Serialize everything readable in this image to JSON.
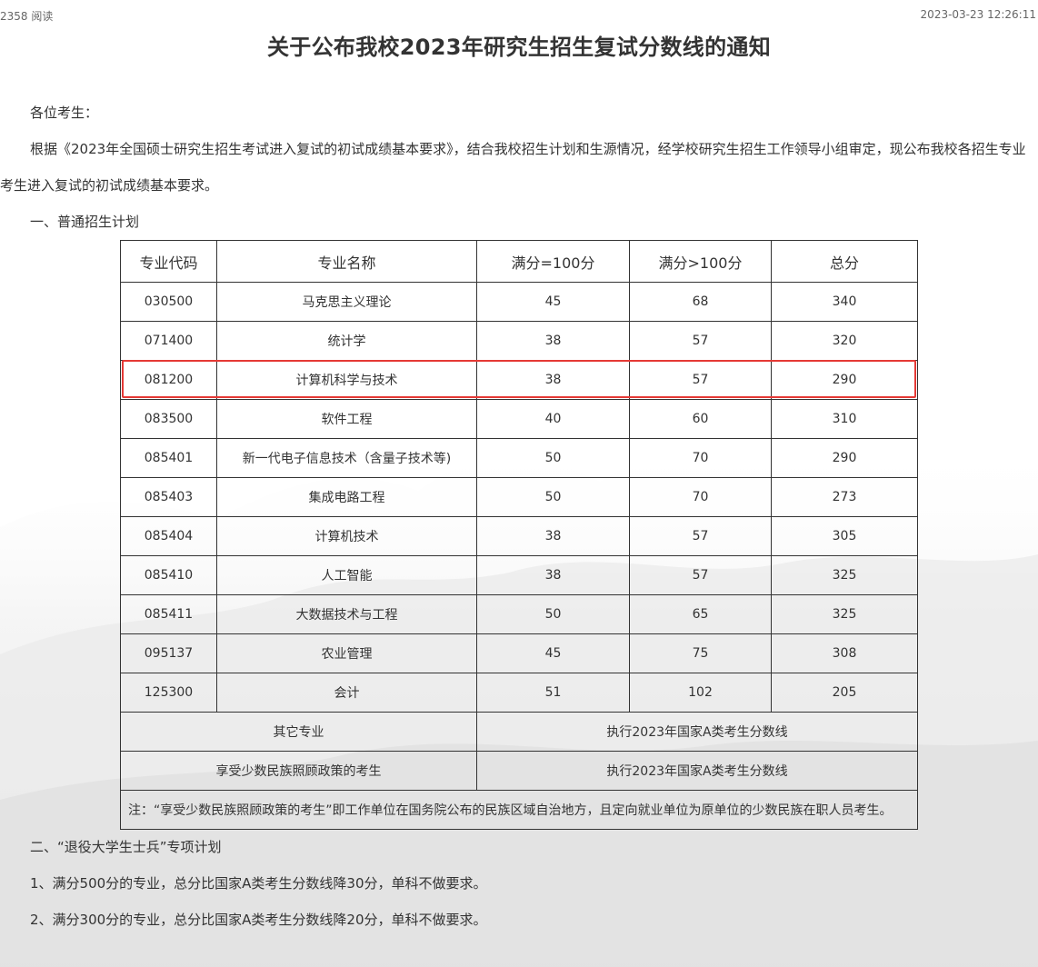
{
  "meta": {
    "views": "2358 阅读",
    "datetime": "2023-03-23 12:26:11"
  },
  "title": "关于公布我校2023年研究生招生复试分数线的通知",
  "greeting": "各位考生：",
  "intro": "根据《2023年全国硕士研究生招生考试进入复试的初试成绩基本要求》，结合我校招生计划和生源情况，经学校研究生招生工作领导小组审定，现公布我校各招生专业考生进入复试的初试成绩基本要求。",
  "section1_heading": "一、普通招生计划",
  "table": {
    "headers": [
      "专业代码",
      "专业名称",
      "满分=100分",
      "满分>100分",
      "总分"
    ],
    "rows": [
      [
        "030500",
        "马克思主义理论",
        "45",
        "68",
        "340"
      ],
      [
        "071400",
        "统计学",
        "38",
        "57",
        "320"
      ],
      [
        "081200",
        "计算机科学与技术",
        "38",
        "57",
        "290"
      ],
      [
        "083500",
        "软件工程",
        "40",
        "60",
        "310"
      ],
      [
        "085401",
        "新一代电子信息技术（含量子技术等)",
        "50",
        "70",
        "290"
      ],
      [
        "085403",
        "集成电路工程",
        "50",
        "70",
        "273"
      ],
      [
        "085404",
        "计算机技术",
        "38",
        "57",
        "305"
      ],
      [
        "085410",
        "人工智能",
        "38",
        "57",
        "325"
      ],
      [
        "085411",
        "大数据技术与工程",
        "50",
        "65",
        "325"
      ],
      [
        "095137",
        "农业管理",
        "45",
        "75",
        "308"
      ],
      [
        "125300",
        "会计",
        "51",
        "102",
        "205"
      ]
    ],
    "other_label": "其它专业",
    "other_value": "执行2023年国家A类考生分数线",
    "minority_label": "享受少数民族照顾政策的考生",
    "minority_value": "执行2023年国家A类考生分数线",
    "note": "注：“享受少数民族照顾政策的考生”即工作单位在国务院公布的民族区域自治地方，且定向就业单位为原单位的少数民族在职人员考生。"
  },
  "section2_heading": "二、“退役大学生士兵”专项计划",
  "section2_items": [
    "1、满分500分的专业，总分比国家A类考生分数线降30分，单科不做要求。",
    "2、满分300分的专业，总分比国家A类考生分数线降20分，单科不做要求。"
  ],
  "colors": {
    "highlight": "#e53935",
    "text": "#333333",
    "border": "#333333"
  }
}
